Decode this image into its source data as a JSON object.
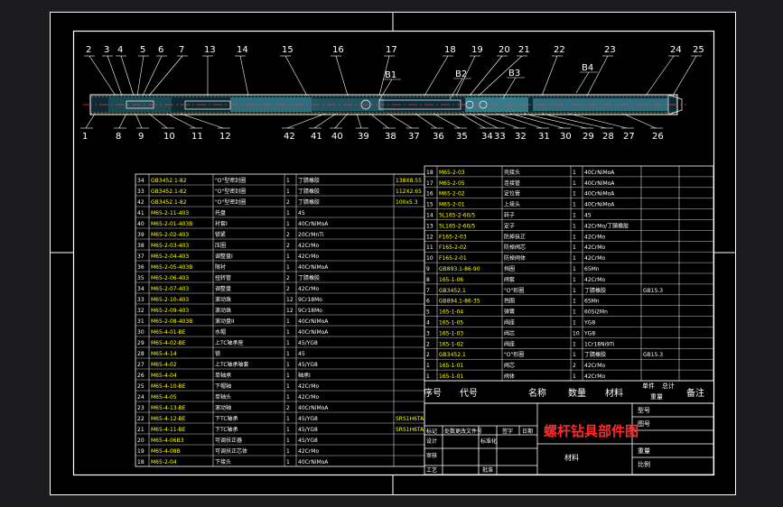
{
  "colors": {
    "outer_bg": "#1c1c1e",
    "paper": "#000000",
    "border": "#ffffff",
    "line": "#ffffff",
    "red_text": "#ff2a2a",
    "yellow_text": "#ffff00",
    "part_fill": "#2c6d7f",
    "part_fill_light": "#4fb4c8",
    "hatch": "#8a7a4a",
    "centerline": "#ff3030"
  },
  "callouts_top": [
    "2",
    "3",
    "4",
    "5",
    "6",
    "7",
    "13",
    "14",
    "15",
    "16",
    "17",
    "18",
    "19",
    "20",
    "21",
    "22",
    "23",
    "24",
    "25"
  ],
  "callouts_bottom": [
    "1",
    "8",
    "9",
    "10",
    "11",
    "12",
    "42",
    "41",
    "40",
    "39",
    "38",
    "37",
    "36",
    "35",
    "34",
    "33",
    "32",
    "31",
    "30",
    "29",
    "28",
    "27",
    "26"
  ],
  "section_labels": [
    "B1",
    "B2",
    "B3",
    "B4"
  ],
  "left_table_rows": [
    [
      "34",
      "GB3452.1-82",
      "\"O\"型密封圈",
      "1",
      "丁腈橡胶",
      "138X8.55"
    ],
    [
      "33",
      "GB3452.1-82",
      "\"O\"型密封圈",
      "1",
      "丁腈橡胶",
      "112X2.65"
    ],
    [
      "42",
      "GB3452.1-82",
      "\"O\"型密封圈",
      "2",
      "丁腈橡胶",
      "100x5.3"
    ],
    [
      "41",
      "M65-2-11-403",
      "托盘",
      "1",
      "45",
      ""
    ],
    [
      "40",
      "M65-2-01-403B",
      "衬套I",
      "1",
      "40CrNiMoA",
      ""
    ],
    [
      "39",
      "M65-2-02-403",
      "锁紧",
      "2",
      "20CrMnTi",
      ""
    ],
    [
      "38",
      "M65-2-03-403",
      "压圈",
      "2",
      "42CrMo",
      ""
    ],
    [
      "37",
      "M65-2-04-403",
      "调整盘I",
      "1",
      "42CrMo",
      ""
    ],
    [
      "36",
      "M65-2-05-403B",
      "限衬",
      "1",
      "40CrNiMoA",
      ""
    ],
    [
      "35",
      "M65-2-06-403",
      "扭转管",
      "2",
      "丁腈橡胶",
      ""
    ],
    [
      "34",
      "M65-2-07-403",
      "调整盘",
      "2",
      "42CrMo",
      ""
    ],
    [
      "33",
      "M65-2-10-403",
      "滚动珠",
      "12",
      "9Cr18Mo",
      ""
    ],
    [
      "32",
      "M65-2-09-403",
      "滚动珠",
      "12",
      "9Cr18Mo",
      ""
    ],
    [
      "31",
      "M65-2-08-403B",
      "滚动盘II",
      "1",
      "40CrNiMoA",
      ""
    ],
    [
      "30",
      "M65-4-01-BE",
      "水帽",
      "1",
      "40CrNiMoA",
      ""
    ],
    [
      "29",
      "M65-4-02-BE",
      "上TC轴承座",
      "1",
      "45/YG8",
      ""
    ],
    [
      "28",
      "M65-4-14",
      "锁",
      "1",
      "45",
      ""
    ],
    [
      "27",
      "M65-4-02",
      "上TC轴承轴套",
      "1",
      "45/YG8",
      ""
    ],
    [
      "26",
      "M65-4-04",
      "单轴承",
      "1",
      "轴承I",
      ""
    ],
    [
      "25",
      "M65-4-10-BE",
      "下帽轴",
      "1",
      "42CrMo",
      ""
    ],
    [
      "24",
      "M65-4-05",
      "单轴头",
      "1",
      "42CrMo",
      ""
    ],
    [
      "23",
      "M65-4-13-BE",
      "滚动轴",
      "2",
      "40CrNiMoA",
      ""
    ],
    [
      "22",
      "M65-4-12-BE",
      "下TC轴承",
      "1",
      "45/YG8",
      "SRS1H6TA"
    ],
    [
      "21",
      "M65-4-11-BE",
      "下TC轴承",
      "1",
      "45/YG8",
      "SRS1H6TA"
    ],
    [
      "20",
      "M65-4-06B3",
      "可调扶正器",
      "1",
      "45/YG8",
      ""
    ],
    [
      "19",
      "M65-4-08B",
      "可调扶正芯体",
      "1",
      "42CrMo",
      ""
    ],
    [
      "18",
      "M65-2-04",
      "下接头",
      "1",
      "40CrNiMoA",
      ""
    ]
  ],
  "right_table_rows": [
    [
      "18",
      "M65-2-03",
      "壳接头",
      "1",
      "40CrNiMoA",
      ""
    ],
    [
      "17",
      "M65-2-05",
      "连接管",
      "1",
      "40CrNiMoA",
      ""
    ],
    [
      "16",
      "M65-2-02",
      "定位管",
      "1",
      "40CrNiMoA",
      ""
    ],
    [
      "15",
      "M65-2-01",
      "上接头",
      "1",
      "40CrNiMoA",
      ""
    ],
    [
      "14",
      "5L165-2-60/5",
      "转子",
      "1",
      "45",
      ""
    ],
    [
      "13",
      "5L165-2-60/5",
      "定子",
      "1",
      "42CrMo/丁腈橡胶",
      ""
    ],
    [
      "12",
      "F165-2-03",
      "防掉扶正",
      "1",
      "42CrMo",
      ""
    ],
    [
      "11",
      "F165-2-02",
      "防掉阀芯",
      "1",
      "42CrMo",
      ""
    ],
    [
      "10",
      "F165-2-01",
      "防掉阀体",
      "1",
      "42CrMo",
      ""
    ],
    [
      "9",
      "GB893.1-86-90",
      "挡圈",
      "1",
      "65Mn",
      ""
    ],
    [
      "8",
      "165-1-06",
      "阀套",
      "1",
      "42CrMo",
      ""
    ],
    [
      "7",
      "GB3452.1",
      "\"O\"形圈",
      "1",
      "丁腈橡胶",
      "GB15.3"
    ],
    [
      "6",
      "GB894.1-86-35",
      "挡圈",
      "1",
      "65Mn",
      ""
    ],
    [
      "5",
      "165-1-04",
      "弹簧",
      "1",
      "60Si2Mn",
      ""
    ],
    [
      "4",
      "165-1-05",
      "阀座",
      "1",
      "YG8",
      ""
    ],
    [
      "3",
      "165-1-03",
      "阀芯",
      "10",
      "YG8",
      ""
    ],
    [
      "2",
      "165-1-02",
      "阀座",
      "1",
      "1Cr18Ni9Ti",
      ""
    ],
    [
      "2",
      "GB3452.1",
      "\"O\"形圈",
      "1",
      "丁腈橡胶",
      "GB15.3"
    ],
    [
      "1",
      "165-1-01",
      "阀芯",
      "2",
      "42CrMo",
      ""
    ],
    [
      "1",
      "165-1-01",
      "阀体",
      "1",
      "42CrMo",
      ""
    ]
  ],
  "right_table_header": {
    "seq": "序号",
    "code": "代号",
    "name": "名称",
    "qty": "数量",
    "material": "材料",
    "unit_weight": "单件",
    "total_weight": "总计",
    "weight": "重量",
    "remark": "备注"
  },
  "title_block": {
    "title": "螺杆钻具部件图",
    "mark": "标记",
    "count": "处数",
    "change_doc": "更改文件号",
    "signature": "签字",
    "date": "日期",
    "designer": "设计",
    "standardize": "标准化",
    "reviewer": "审核",
    "craft": "工艺",
    "approve": "批准",
    "material": "材料",
    "model_no": "型号",
    "drawing_no": "图号",
    "weight": "重量",
    "scale": "比例"
  }
}
